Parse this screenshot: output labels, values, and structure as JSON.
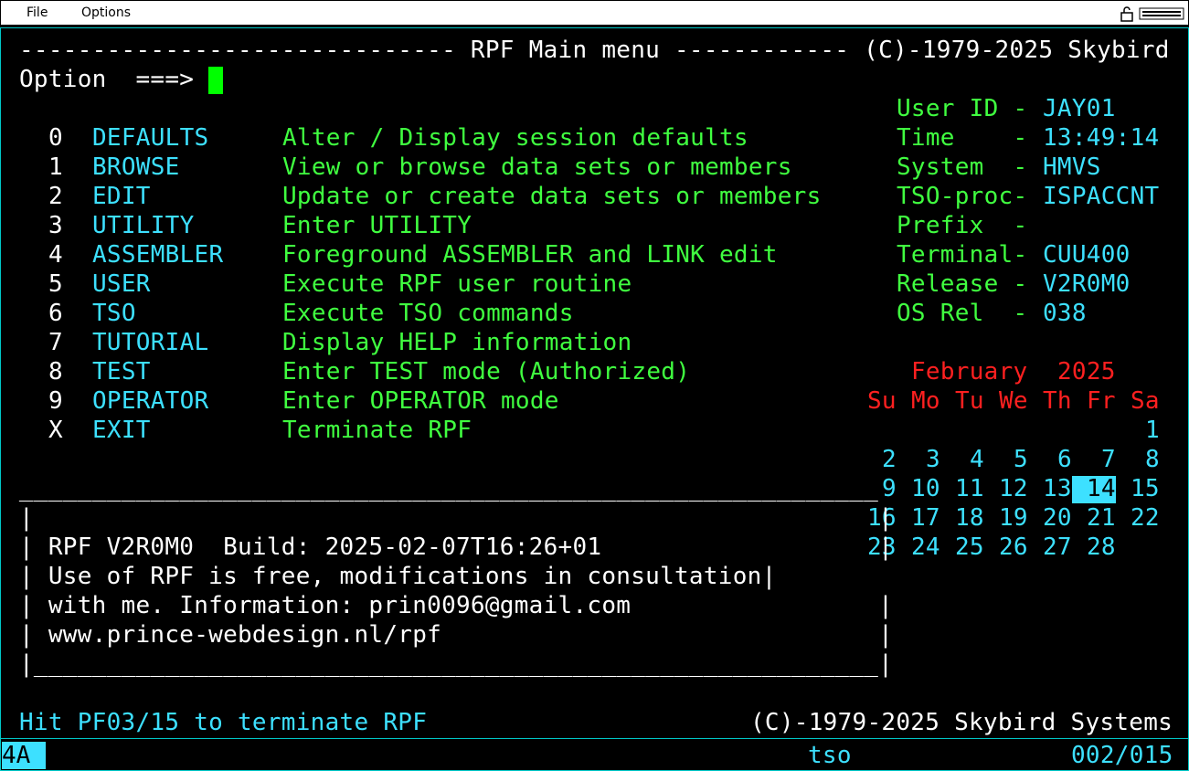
{
  "menubar": {
    "file": "File",
    "options": "Options",
    "icons": [
      "lock-icon",
      "keyboard-icon"
    ]
  },
  "header": {
    "title_line": "------------------------------ RPF Main menu ------------ (C)-1979-2025 Skybird",
    "option_label": "Option  ===>"
  },
  "menu_items": [
    {
      "key": "0",
      "name": "DEFAULTS",
      "desc": "Alter / Display session defaults"
    },
    {
      "key": "1",
      "name": "BROWSE",
      "desc": "View or browse data sets or members"
    },
    {
      "key": "2",
      "name": "EDIT",
      "desc": "Update or create data sets or members"
    },
    {
      "key": "3",
      "name": "UTILITY",
      "desc": "Enter UTILITY"
    },
    {
      "key": "4",
      "name": "ASSEMBLER",
      "desc": "Foreground ASSEMBLER and LINK edit"
    },
    {
      "key": "5",
      "name": "USER",
      "desc": "Execute RPF user routine"
    },
    {
      "key": "6",
      "name": "TSO",
      "desc": "Execute TSO commands"
    },
    {
      "key": "7",
      "name": "TUTORIAL",
      "desc": "Display HELP information"
    },
    {
      "key": "8",
      "name": "TEST",
      "desc": "Enter TEST mode (Authorized)"
    },
    {
      "key": "9",
      "name": "OPERATOR",
      "desc": "Enter OPERATOR mode"
    },
    {
      "key": "X",
      "name": "EXIT",
      "desc": "Terminate RPF"
    }
  ],
  "info": [
    {
      "label": "User ID -",
      "value": "JAY01"
    },
    {
      "label": "Time    -",
      "value": "13:49:14"
    },
    {
      "label": "System  -",
      "value": "HMVS"
    },
    {
      "label": "TSO-proc-",
      "value": "ISPACCNT"
    },
    {
      "label": "Prefix  -",
      "value": ""
    },
    {
      "label": "Terminal-",
      "value": "CUU400"
    },
    {
      "label": "Release -",
      "value": "V2R0M0"
    },
    {
      "label": "OS Rel  -",
      "value": "038"
    }
  ],
  "calendar": {
    "month": "February",
    "year": "2025",
    "weekdays": [
      "Su",
      "Mo",
      "Tu",
      "We",
      "Th",
      "Fr",
      "Sa"
    ],
    "weeks": [
      [
        "",
        "",
        "",
        "",
        "",
        "",
        "1"
      ],
      [
        "2",
        "3",
        "4",
        "5",
        "6",
        "7",
        "8"
      ],
      [
        "9",
        "10",
        "11",
        "12",
        "13",
        "14",
        "15"
      ],
      [
        "16",
        "17",
        "18",
        "19",
        "20",
        "21",
        "22"
      ],
      [
        "23",
        "24",
        "25",
        "26",
        "27",
        "28",
        ""
      ]
    ],
    "today": "14"
  },
  "box": {
    "top": " ___________________________________________________________",
    "lines": [
      "|                                                          |",
      "| RPF V2R0M0  Build: 2025-02-07T16:26+01                   |",
      "| Use of RPF is free, modifications in consultation|",
      "| with me. Information: prin0096@gmail.com                 |",
      "| www.prince-webdesign.nl/rpf                              |",
      "|__________________________________________________________|"
    ]
  },
  "footer": {
    "hint": "Hit PF03/15 to terminate RPF",
    "copyright": "(C)-1979-2025 Skybird Systems"
  },
  "oia": {
    "mode": "4A",
    "app": "tso",
    "cursor_pos": "002/015"
  },
  "colors": {
    "green": "#40ff40",
    "cyan": "#3de0ff",
    "red": "#ff2020",
    "white": "#ffffff"
  }
}
